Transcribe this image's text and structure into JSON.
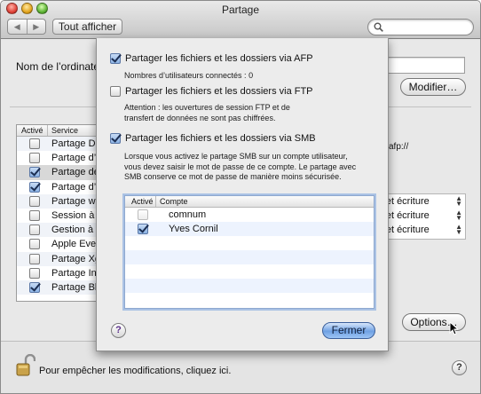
{
  "window": {
    "title": "Partage"
  },
  "toolbar": {
    "back": "◀",
    "forward": "▶",
    "show_all": "Tout afficher",
    "search_placeholder": ""
  },
  "pane": {
    "computer_name_label": "Nom de l’ordinateur",
    "modify_label": "Modifier…",
    "afp_url": "afp://",
    "services_header": {
      "active": "Activé",
      "service": "Service"
    },
    "services": [
      {
        "label": "Partage D",
        "checked": false
      },
      {
        "label": "Partage d’",
        "checked": false
      },
      {
        "label": "Partage de",
        "checked": true
      },
      {
        "label": "Partage d’",
        "checked": true
      },
      {
        "label": "Partage we",
        "checked": false
      },
      {
        "label": "Session à",
        "checked": false
      },
      {
        "label": "Gestion à",
        "checked": false
      },
      {
        "label": "Apple Eve",
        "checked": false
      },
      {
        "label": "Partage Xg",
        "checked": false
      },
      {
        "label": "Partage In",
        "checked": false
      },
      {
        "label": "Partage Bl",
        "checked": true
      }
    ],
    "access_rows": [
      "re et écriture",
      "re et écriture",
      "re et écriture"
    ],
    "options_label": "Options…",
    "lock_text": "Pour empêcher les modifications, cliquez ici.",
    "help": "?"
  },
  "sheet": {
    "afp_label": "Partager les fichiers et les dossiers via AFP",
    "afp_users": "Nombres d’utilisateurs connectés :  0",
    "ftp_label": "Partager les fichiers et les dossiers via FTP",
    "ftp_note_1": "Attention : les ouvertures de session FTP et de",
    "ftp_note_2": "transfert de données ne sont pas chiffrées.",
    "smb_label": "Partager les fichiers et les dossiers via SMB",
    "smb_note_1": "Lorsque vous activez le partage SMB sur un compte utilisateur,",
    "smb_note_2": "vous devez saisir le mot de passe de ce compte. Le partage avec",
    "smb_note_3": "SMB conserve ce mot de passe de manière moins sécurisée.",
    "table_header": {
      "active": "Activé",
      "account": "Compte"
    },
    "accounts": [
      {
        "name": "comnum",
        "checked": false
      },
      {
        "name": "Yves Cornil",
        "checked": true
      }
    ],
    "help": "?",
    "close_label": "Fermer"
  }
}
